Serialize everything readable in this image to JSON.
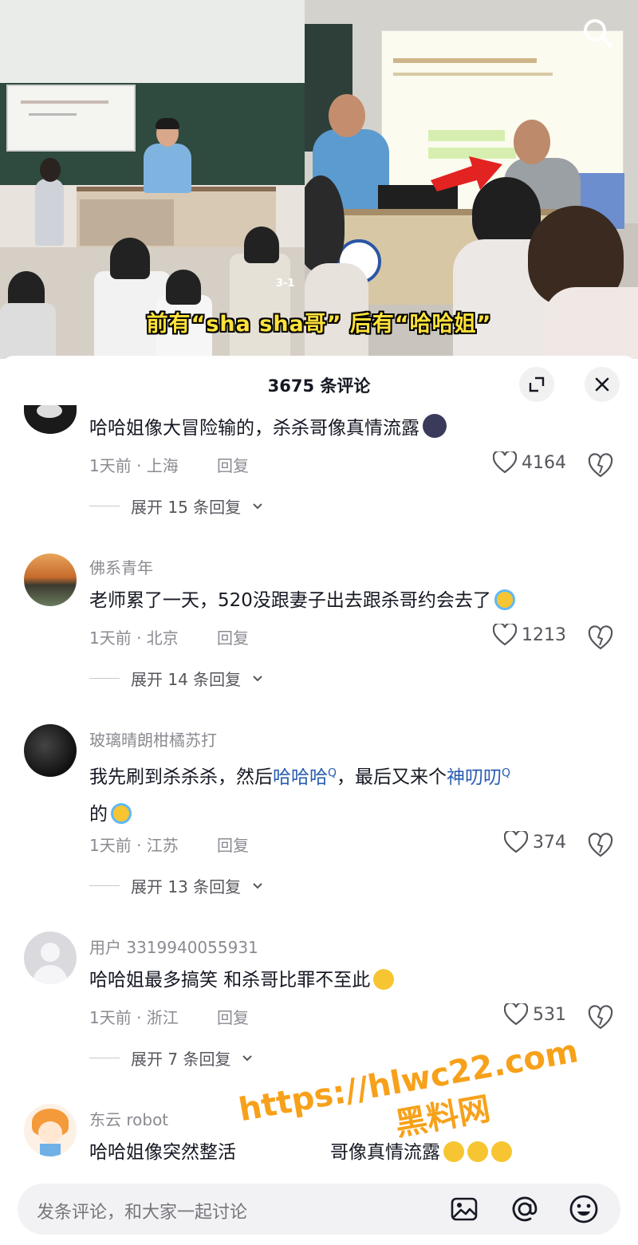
{
  "video": {
    "caption": "前有“sha sha哥” 后有“哈哈姐”",
    "frame_counter": "3-1"
  },
  "sheet": {
    "title": "3675 条评论"
  },
  "comments": [
    {
      "user": "",
      "text": "哈哈姐像大冒险输的，杀杀哥像真情流露",
      "emoji": "smiling-face-emoji",
      "time_location": "1天前 · 上海",
      "reply_label": "回复",
      "likes": "4164",
      "expand_label": "展开 15 条回复"
    },
    {
      "user": "佛系青年",
      "text": "老师累了一天，520没跟妻子出去跟杀哥约会去了",
      "emoji": "tears-of-joy-emoji",
      "time_location": "1天前 · 北京",
      "reply_label": "回复",
      "likes": "1213",
      "expand_label": "展开 14 条回复"
    },
    {
      "user": "玻璃晴朗柑橘苏打",
      "text_parts": [
        "我先刷到杀杀杀，然后",
        "哈哈哈",
        "，最后又来个",
        "神叨叨",
        "的"
      ],
      "emoji": "tears-of-joy-emoji",
      "time_location": "1天前 · 江苏",
      "reply_label": "回复",
      "likes": "374",
      "expand_label": "展开 13 条回复"
    },
    {
      "user": "用户 3319940055931",
      "text": "哈哈姐最多搞笑 和杀哥比罪不至此",
      "emoji": "yum-face-emoji",
      "time_location": "1天前 · 浙江",
      "reply_label": "回复",
      "likes": "531",
      "expand_label": "展开 7 条回复"
    },
    {
      "user": "东云 robot",
      "text": "哈哈姐像突然整活",
      "text_hidden_tail": "哥像真情流露",
      "emoji": "dizzy-face-emoji"
    }
  ],
  "input": {
    "placeholder": "发条评论，和大家一起讨论"
  },
  "watermark": {
    "url": "https://hlwc22.com",
    "name": "黑料网"
  },
  "colors": {
    "text": "#161823",
    "muted": "#8a8b91",
    "link": "#2a5db0",
    "caption": "#ffe23a",
    "watermark": "#f7a11a"
  }
}
